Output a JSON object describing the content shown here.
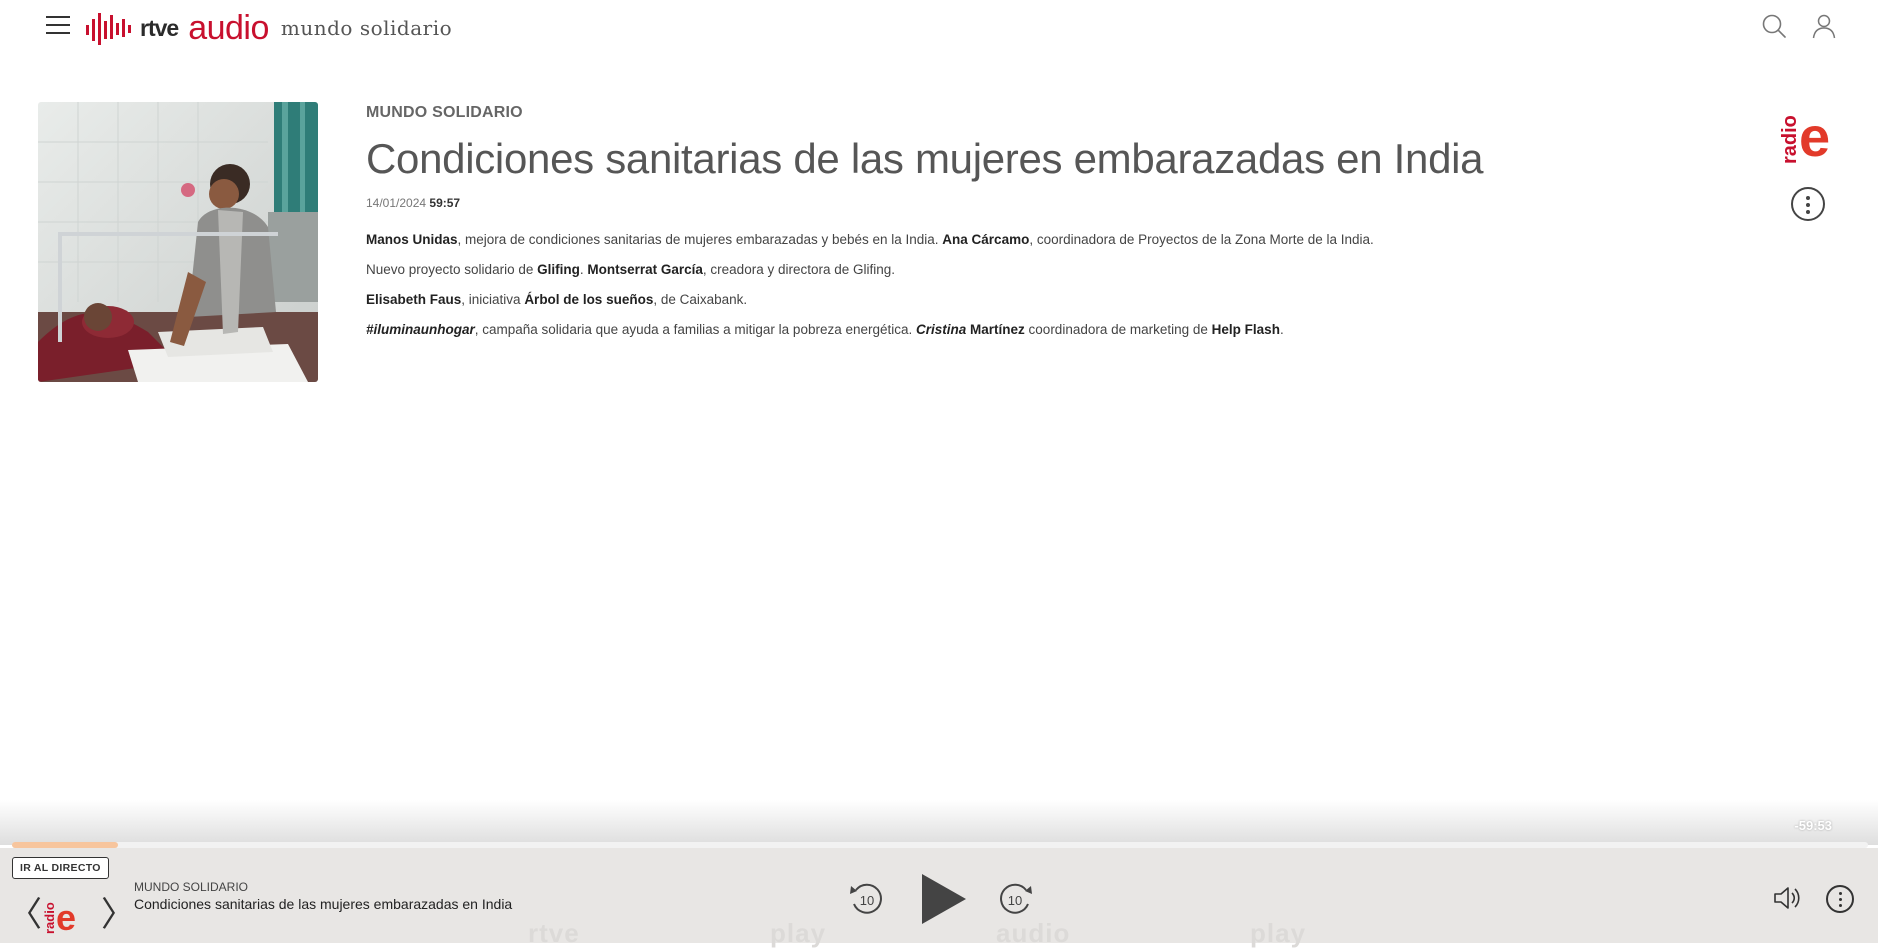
{
  "header": {
    "brand_rtve": "rtve",
    "brand_audio": "audio",
    "program_name": "mundo solidario",
    "icons": [
      "menu-icon",
      "search-icon",
      "user-icon"
    ]
  },
  "episode": {
    "kicker": "MUNDO SOLIDARIO",
    "title": "Condiciones sanitarias de las mujeres embarazadas en India",
    "date": "14/01/2024",
    "duration": "59:57",
    "description": {
      "p1": {
        "b1": "Manos Unidas",
        "t1": ", mejora de condiciones sanitarias de mujeres embarazadas y bebés en la India. ",
        "b2": "Ana Cárcamo",
        "t2": ", coordinadora de Proyectos de la Zona Morte de la India."
      },
      "p2": {
        "t1": "Nuevo proyecto solidario de ",
        "b1": "Glifing",
        "t2": ". ",
        "b2": "Montserrat García",
        "t3": ", creadora y directora de Glifing."
      },
      "p3": {
        "b1": "Elisabeth Faus",
        "t1": ", iniciativa ",
        "b2": "Árbol de los sueños",
        "t2": ", de Caixabank."
      },
      "p4": {
        "bi1": "#iluminaunhogar",
        "t1": ", campaña solidaria que ayuda a familias a mitigar la pobreza energética. ",
        "bi2": "Cristina",
        "b1": " Martínez",
        "t2": " coordinadora de marketing de ",
        "b2": "Help Flash",
        "t3": "."
      }
    },
    "station_logo": {
      "small": "radio",
      "big": "e"
    }
  },
  "player": {
    "remaining": "-59:53",
    "progress": 0.057,
    "live_button": "IR AL DIRECTO",
    "now_playing_kicker": "MUNDO SOLIDARIO",
    "now_playing_title": "Condiciones sanitarias de las mujeres embarazadas en India",
    "skip_back_label": "10",
    "skip_forward_label": "10",
    "station_logo": {
      "small": "radio",
      "big": "e"
    },
    "footer_watermarks": [
      "rtve",
      "play",
      "audio",
      "play"
    ]
  },
  "colors": {
    "brand_red": "#c8102e",
    "progress_fill": "#f7c59d",
    "player_bg": "#e8e6e4"
  }
}
